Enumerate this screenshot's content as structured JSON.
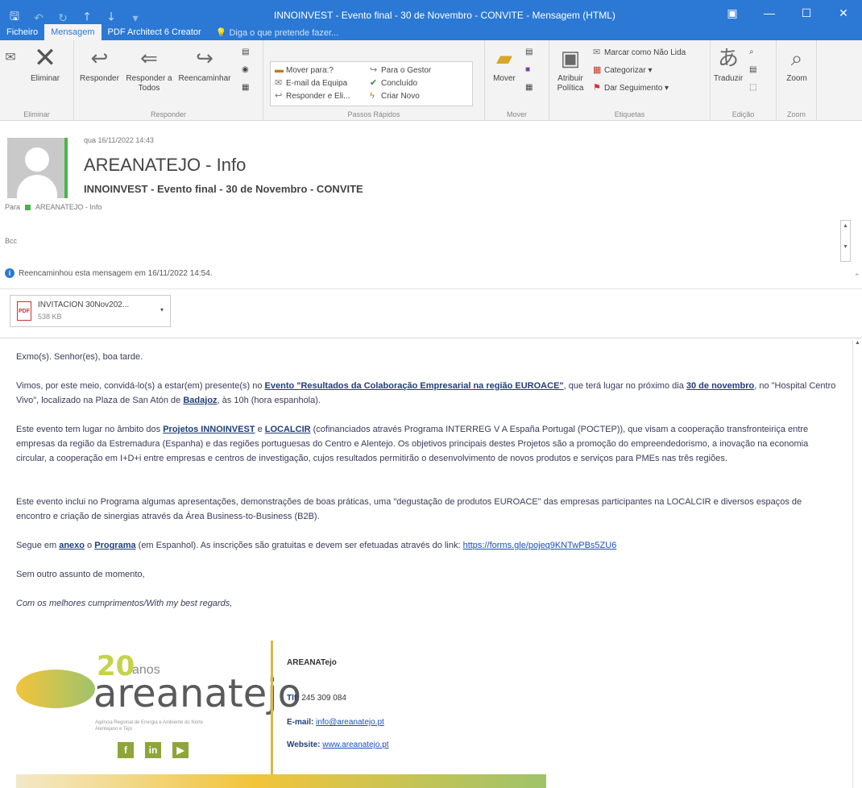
{
  "window": {
    "title": "INNOINVEST - Evento final - 30 de Novembro - CONVITE - Mensagem (HTML)"
  },
  "menu": {
    "tabs": [
      "Ficheiro",
      "Mensagem",
      "PDF Architect 6 Creator"
    ],
    "tell_me": "Diga o que pretende fazer..."
  },
  "ribbon": {
    "delete_label": "Eliminar",
    "reply_label": "Responder",
    "reply_all_label": "Responder a Todos",
    "forward_label": "Reencaminhar",
    "group_eliminar": "Eliminar",
    "group_responder": "Responder",
    "quick_steps": [
      "Mover para:?",
      "E-mail da Equipa",
      "Responder e Eli...",
      "Para o Gestor",
      "Concluído",
      "Criar Novo"
    ],
    "group_passos": "Passos Rápidos",
    "move_label": "Mover",
    "group_mover": "Mover",
    "assign_policy": "Atribuir Política",
    "mark_unread": "Marcar como Não Lida",
    "categorize": "Categorizar",
    "follow_up": "Dar Seguimento",
    "group_etiquetas": "Etiquetas",
    "translate_label": "Traduzir",
    "group_edicao": "Edição",
    "zoom_label": "Zoom",
    "group_zoom": "Zoom"
  },
  "header": {
    "sent_date": "qua 16/11/2022 14:43",
    "sender": "AREANATEJO - Info",
    "subject": "INNOINVEST - Evento final - 30 de Novembro - CONVITE",
    "to_prefix": "Para",
    "to_value": "AREANATEJO - Info",
    "cc_label": "Bcc",
    "forwarded_notice": "Reencaminhou esta mensagem em 16/11/2022 14:54."
  },
  "attachment": {
    "name": "INVITACION 30Nov202...",
    "size": "538 KB"
  },
  "body": {
    "greeting": "Exmo(s). Senhor(es), boa tarde.",
    "p1_a": "Vimos, por este meio, convidá-lo(s) a estar(em) presente(s) no ",
    "p1_event": "Evento \"Resultados da Colaboração Empresarial na região EUROACE\"",
    "p1_b": ", que terá lugar no próximo dia ",
    "p1_date": "30 de novembro",
    "p1_c": ", no \"Hospital Centro Vivo\", localizado na Plaza de San Atón de ",
    "p1_city": "Badajoz",
    "p1_d": ", às 10h (hora espanhola).",
    "p2_a": "Este evento tem lugar no âmbito dos ",
    "p2_proj": "Projetos INNOINVEST",
    "p2_and": " e ",
    "p2_local": "LOCALCIR",
    "p2_b": " (cofinanciados através Programa INTERREG V A España Portugal (POCTEP)), que visam a cooperação transfronteiriça entre empresas da região da Estremadura (Espanha) e das regiões portuguesas do Centro e Alentejo. Os objetivos principais destes Projetos são a promoção do empreendedorismo, a inovação na economia circular, a cooperação em I+D+i entre empresas e centros de investigação, cujos resultados permitirão o desenvolvimento de novos produtos e serviços para PMEs nas três regiões.",
    "p3": "Este evento inclui no Programa algumas apresentações, demonstrações de boas práticas, uma \"degustação de produtos EUROACE\" das empresas participantes na LOCALCIR e diversos espaços de encontro e criação de sinergias através da Área Business-to-Business (B2B).",
    "p4_a": "Segue em ",
    "p4_annex": "anexo",
    "p4_b": " o ",
    "p4_prog": "Programa",
    "p4_c": " (em Espanhol). As inscrições são gratuitas e devem ser efetuadas através do link: ",
    "p4_link": "https://forms.gle/pojeq9KNTwPBs5ZU6",
    "p5": "Sem outro assunto de momento,",
    "p6": "Com os melhores cumprimentos/With my best regards,"
  },
  "signature": {
    "logo_number": "20",
    "logo_anos": "anos",
    "logo_word": "areanatejo",
    "logo_sub": "Agência Regional de Energia e Ambiente do Norte Alentejano e Tejo",
    "name": "AREANATejo",
    "tel_label": "Tlf:",
    "tel": "245 309 084",
    "email_label": "E-mail:",
    "email": "info@areanatejo.pt",
    "website_label": "Website:",
    "website": "www.areanatejo.pt"
  },
  "colors": {
    "titlebar": "#2b79d4",
    "accent_green": "#4ab34a"
  }
}
